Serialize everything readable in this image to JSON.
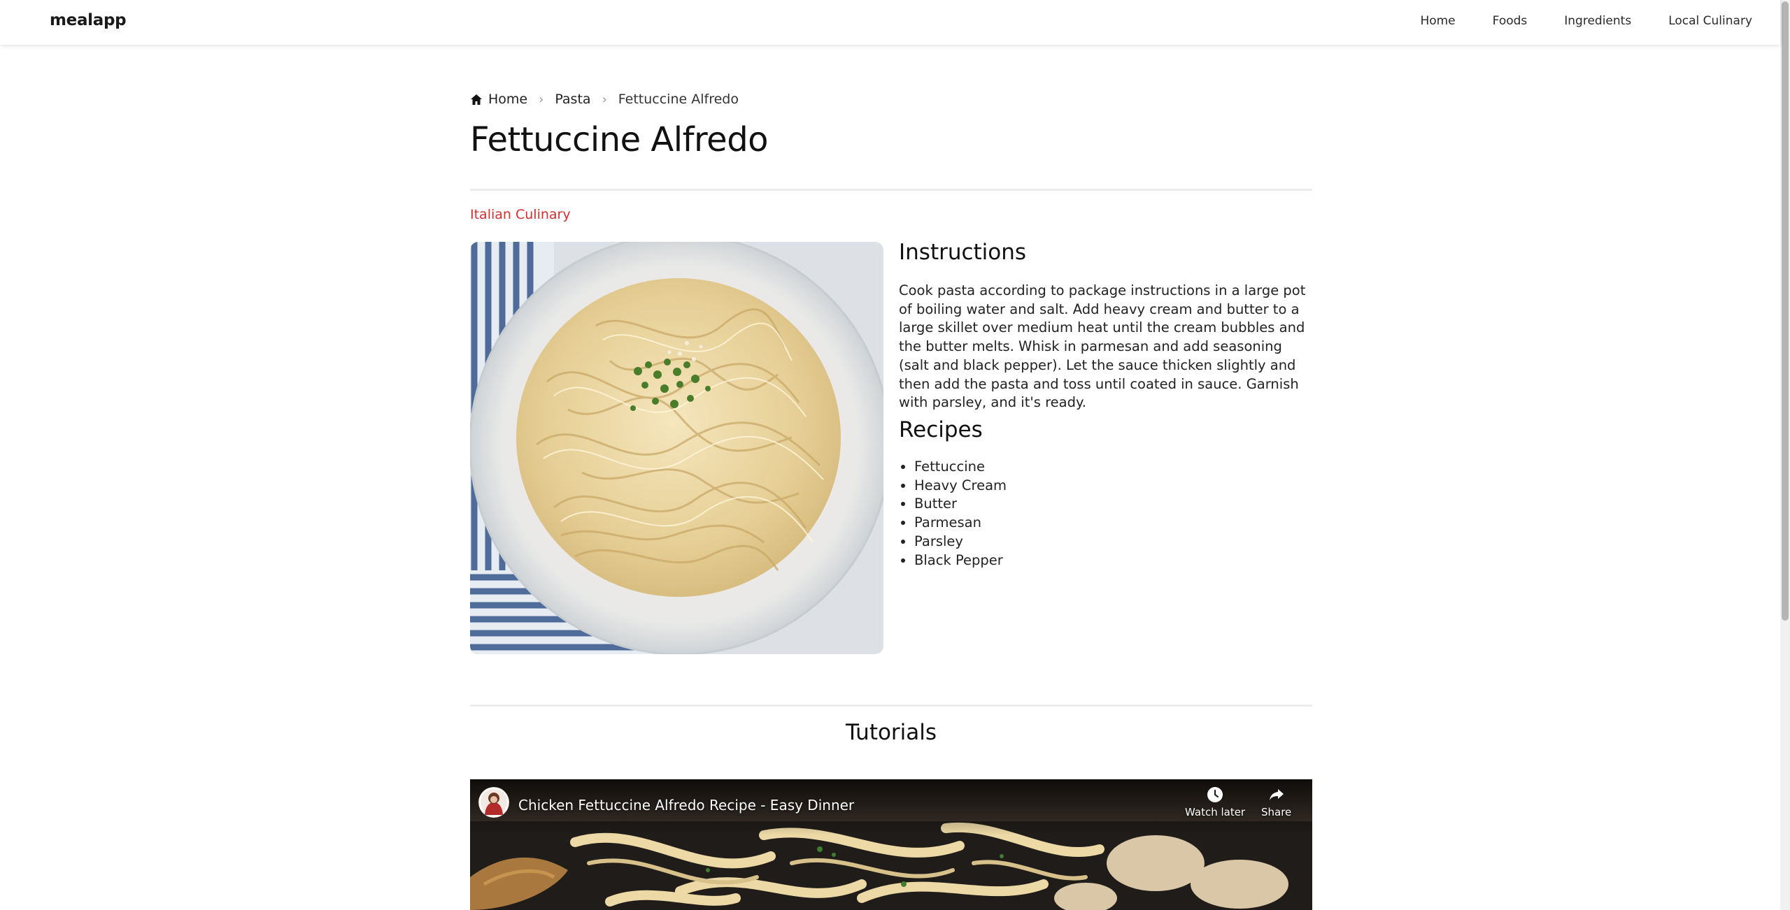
{
  "brand": {
    "name": "mealapp"
  },
  "nav": {
    "links": [
      "Home",
      "Foods",
      "Ingredients",
      "Local Culinary"
    ]
  },
  "breadcrumb": {
    "home": "Home",
    "category": "Pasta",
    "current": "Fettuccine Alfredo"
  },
  "meal": {
    "title": "Fettuccine Alfredo",
    "cuisine": "Italian Culinary",
    "instructions_heading": "Instructions",
    "instructions": "Cook pasta according to package instructions in a large pot of boiling water and salt. Add heavy cream and butter to a large skillet over medium heat until the cream bubbles and the butter melts. Whisk in parmesan and add seasoning (salt and black pepper). Let the sauce thicken slightly and then add the pasta and toss until coated in sauce. Garnish with parsley, and it's ready.",
    "recipes_heading": "Recipes",
    "ingredients": [
      "Fettuccine",
      "Heavy Cream",
      "Butter",
      "Parmesan",
      "Parsley",
      "Black Pepper"
    ]
  },
  "tutorials": {
    "heading": "Tutorials",
    "video": {
      "title": "Chicken Fettuccine Alfredo Recipe - Easy Dinner",
      "watch_later": "Watch later",
      "share": "Share"
    }
  },
  "colors": {
    "accent": "#d32f2f",
    "text": "#222222",
    "divider": "#ececec",
    "plate": "#f4f4f2",
    "pasta": "#ead7a6",
    "napkin": "#4e6b9a"
  }
}
